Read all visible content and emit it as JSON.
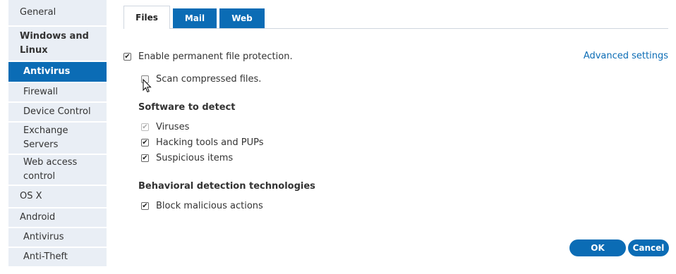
{
  "sidebar": {
    "items": [
      {
        "label": "General",
        "style": "normal"
      },
      {
        "label": "Windows and Linux",
        "style": "bold"
      },
      {
        "label": "Antivirus",
        "style": "active-sub"
      },
      {
        "label": "Firewall",
        "style": "sub"
      },
      {
        "label": "Device Control",
        "style": "sub"
      },
      {
        "label": "Exchange Servers",
        "style": "sub"
      },
      {
        "label": "Web access control",
        "style": "sub"
      },
      {
        "label": "OS X",
        "style": "normal"
      },
      {
        "label": "Android",
        "style": "normal"
      },
      {
        "label": "Antivirus",
        "style": "sub"
      },
      {
        "label": "Anti-Theft",
        "style": "sub"
      }
    ]
  },
  "tabs": [
    {
      "label": "Files",
      "active": true
    },
    {
      "label": "Mail",
      "active": false
    },
    {
      "label": "Web",
      "active": false
    }
  ],
  "main": {
    "enable_protection": {
      "label": "Enable permanent file protection.",
      "checked": true
    },
    "advanced_settings_link": "Advanced settings",
    "scan_compressed": {
      "label": "Scan compressed files.",
      "checked": false
    },
    "software_heading": "Software to detect",
    "software_items": [
      {
        "label": "Viruses",
        "checked": true,
        "disabled": true
      },
      {
        "label": "Hacking tools and PUPs",
        "checked": true,
        "disabled": false
      },
      {
        "label": "Suspicious items",
        "checked": true,
        "disabled": false
      }
    ],
    "behavioral_heading": "Behavioral detection technologies",
    "behavioral_items": [
      {
        "label": "Block malicious actions",
        "checked": true
      }
    ]
  },
  "buttons": {
    "ok": "OK",
    "cancel": "Cancel"
  },
  "colors": {
    "accent": "#0b6cb5",
    "nav_bg": "#e9eef5"
  }
}
